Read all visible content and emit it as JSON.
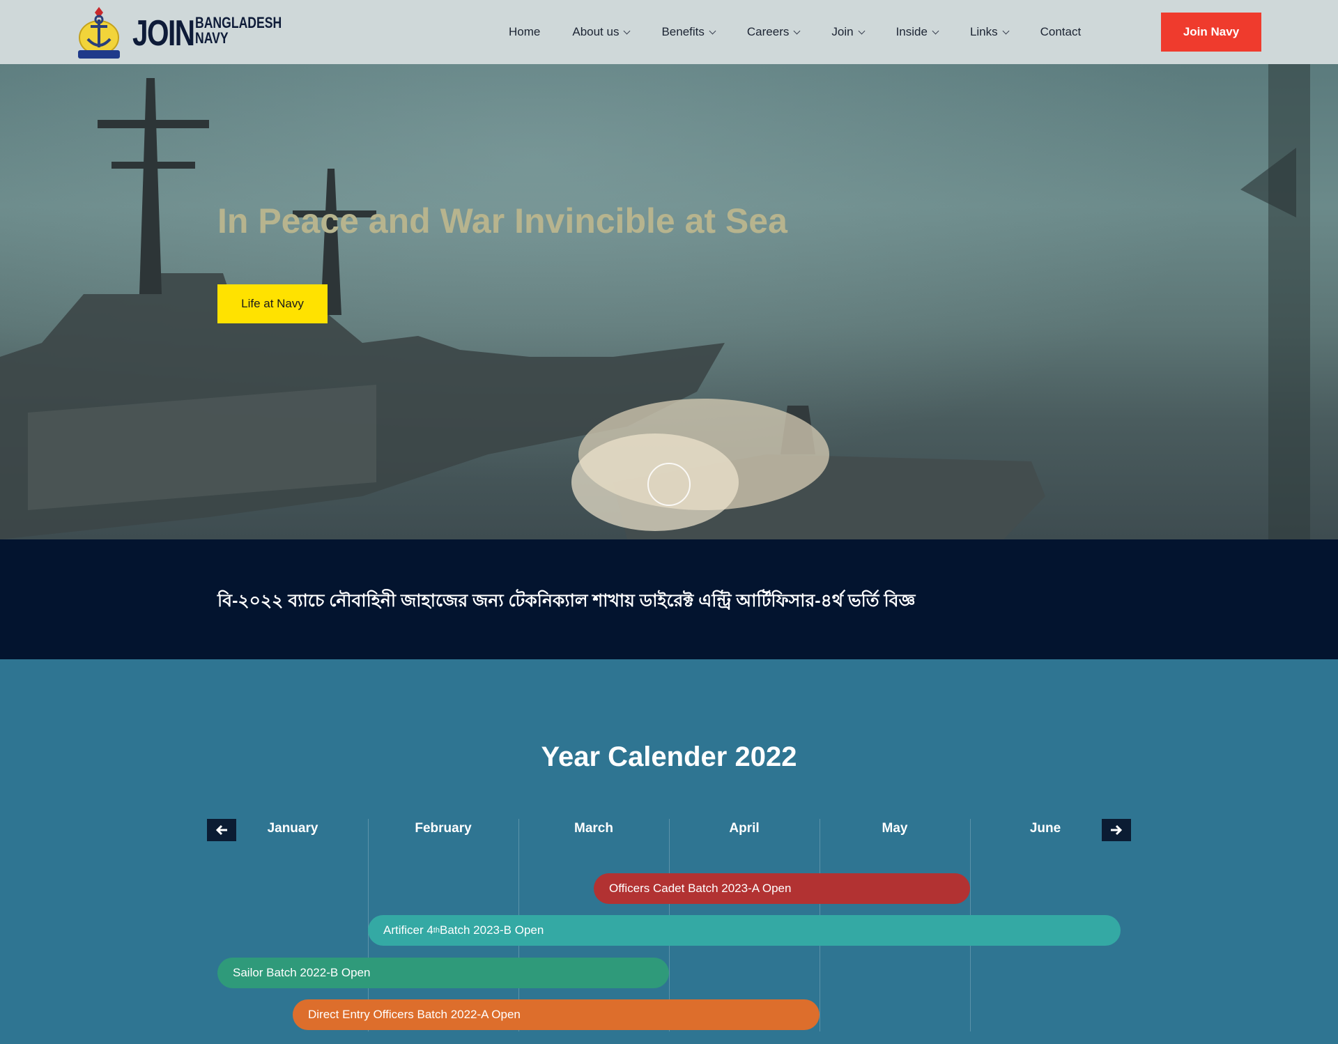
{
  "header": {
    "logo": {
      "join": "JOIN",
      "sub_line1": "BANGLADESH",
      "sub_line2": "NAVY"
    },
    "nav": [
      {
        "label": "Home",
        "has_dropdown": false
      },
      {
        "label": "About us",
        "has_dropdown": true
      },
      {
        "label": "Benefits",
        "has_dropdown": true
      },
      {
        "label": "Careers",
        "has_dropdown": true
      },
      {
        "label": "Join",
        "has_dropdown": true
      },
      {
        "label": "Inside",
        "has_dropdown": true
      },
      {
        "label": "Links",
        "has_dropdown": true
      },
      {
        "label": "Contact",
        "has_dropdown": false
      }
    ],
    "cta_label": "Join Navy"
  },
  "hero": {
    "title": "In Peace and War Invincible at Sea",
    "button_label": "Life at Navy"
  },
  "notice": {
    "text": "বি-২০২২ ব্যাচে নৌবাহিনী জাহাজের জন্য টেকনিক্যাল শাখায় ডাইরেক্ট এন্ট্রি আর্টিফিসার-৪র্থ ভর্তি বিজ্ঞ"
  },
  "calendar": {
    "title": "Year Calender 2022",
    "prev_icon": "arrow-left-icon",
    "next_icon": "arrow-right-icon",
    "months": [
      "January",
      "February",
      "March",
      "April",
      "May",
      "June"
    ],
    "events": [
      {
        "label": "Officers Cadet Batch 2023-A Open",
        "start_month": 2.5,
        "end_month": 5.0,
        "color": "#b23232"
      },
      {
        "label_pre": "Artificer 4",
        "label_sup": "th",
        "label_post": " Batch 2023-B Open",
        "start_month": 1.0,
        "end_month": 6.0,
        "color": "#34a9a4"
      },
      {
        "label": "Sailor Batch 2022-B Open",
        "start_month": 0.0,
        "end_month": 3.0,
        "color": "#2f9a7a"
      },
      {
        "label": "Direct Entry Officers Batch 2022-A Open",
        "start_month": 0.5,
        "end_month": 4.0,
        "color": "#dd6e2c"
      }
    ]
  },
  "colors": {
    "header_bg": "#cfd8d9",
    "cta": "#ef3b2d",
    "hero_button": "#ffe200",
    "notice_bg": "#03142f",
    "calendar_bg": "#2f7592"
  }
}
